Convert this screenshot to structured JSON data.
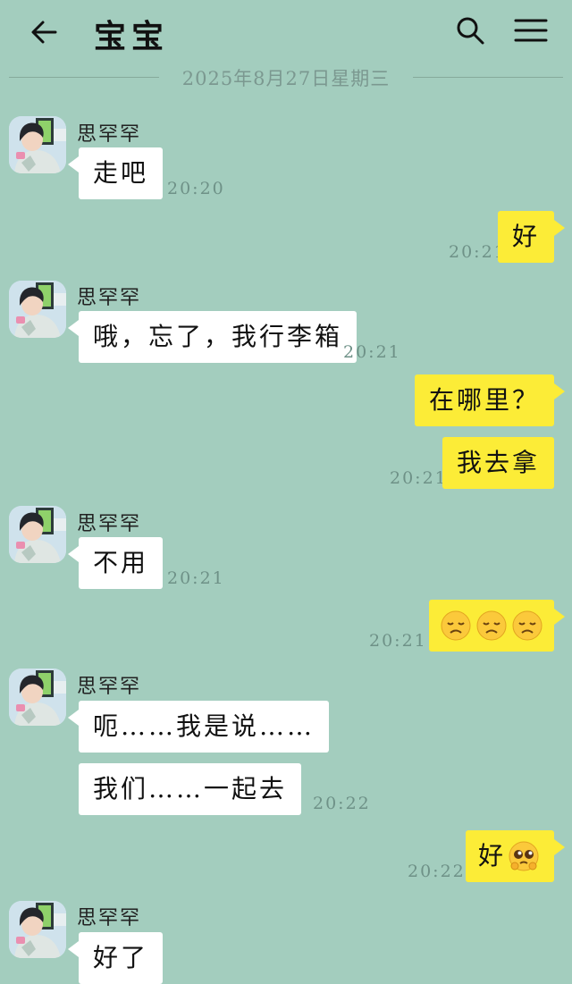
{
  "header": {
    "title": "宝宝",
    "back_icon": "arrow-left-icon",
    "search_icon": "search-icon",
    "menu_icon": "hamburger-menu-icon"
  },
  "date_divider": "2025年8月27日星期三",
  "contact": {
    "name": "思罕罕"
  },
  "colors": {
    "background": "#a3cdbe",
    "incoming_bubble": "#ffffff",
    "outgoing_bubble": "#fcec37"
  },
  "messages": [
    {
      "from": "them",
      "text": "走吧",
      "time": "20:20"
    },
    {
      "from": "me",
      "text": "好",
      "time": "20:21"
    },
    {
      "from": "them",
      "text": "哦，忘了，我行李箱",
      "time": "20:21"
    },
    {
      "from": "me",
      "text": "在哪里？",
      "time": ""
    },
    {
      "from": "me",
      "text": "我去拿",
      "time": "20:21"
    },
    {
      "from": "them",
      "text": "不用",
      "time": "20:21"
    },
    {
      "from": "me",
      "text": "",
      "emojis": [
        "disappointed-face",
        "disappointed-face",
        "disappointed-face"
      ],
      "time": "20:21"
    },
    {
      "from": "them",
      "text": "呃……我是说……",
      "time": ""
    },
    {
      "from": "them",
      "text": "我们……一起去",
      "time": "20:22"
    },
    {
      "from": "me",
      "text": "好",
      "emojis": [
        "pleading-face"
      ],
      "time": "20:22"
    },
    {
      "from": "them",
      "text": "好了",
      "time": ""
    }
  ]
}
